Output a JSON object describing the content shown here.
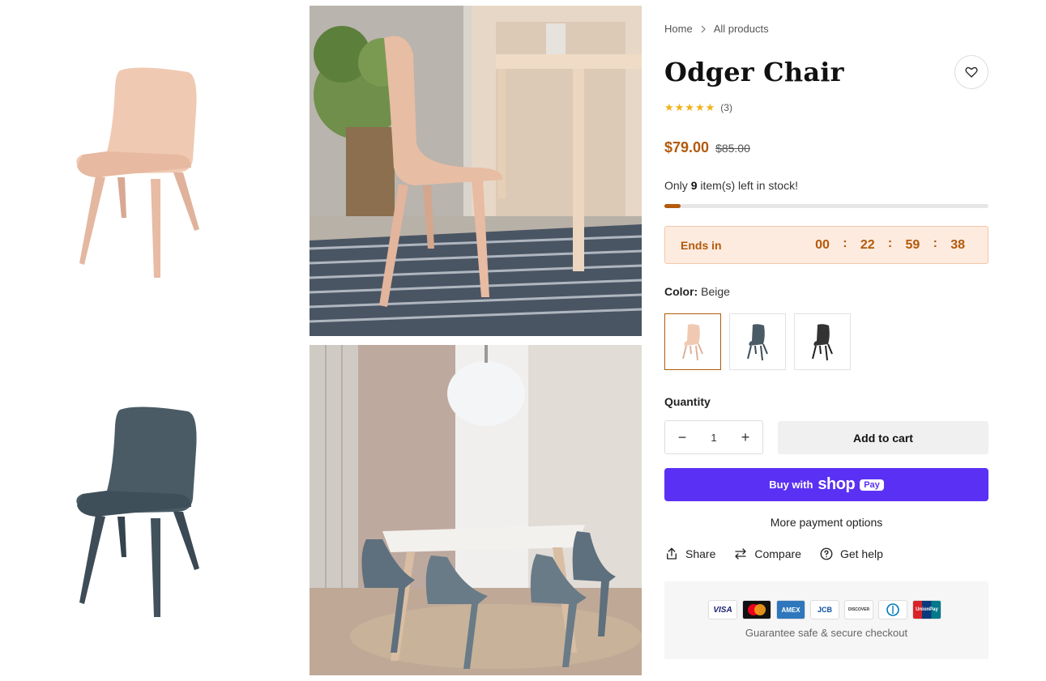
{
  "breadcrumb": {
    "home": "Home",
    "current": "All products"
  },
  "product": {
    "title": "Odger Chair",
    "rating_stars": "★★★★★",
    "review_count": "(3)",
    "price": "$79.00",
    "compare_price": "$85.00"
  },
  "stock": {
    "prefix": "Only",
    "count": "9",
    "suffix": "item(s) left in stock!",
    "progress_fraction": 0.05
  },
  "countdown": {
    "label": "Ends in",
    "days": "00",
    "hours": "22",
    "minutes": "59",
    "seconds": "38"
  },
  "color": {
    "label": "Color:",
    "selected": "Beige",
    "options": [
      "Beige",
      "Blue",
      "Black"
    ]
  },
  "quantity": {
    "label": "Quantity",
    "value": "1",
    "minus": "−",
    "plus": "+"
  },
  "buttons": {
    "add_to_cart": "Add to cart",
    "buy_with": "Buy with",
    "shop": "shop",
    "pay": "Pay",
    "more_payment": "More payment options"
  },
  "actions": {
    "share": "Share",
    "compare": "Compare",
    "help": "Get help"
  },
  "payment_cards": [
    "VISA",
    "MC",
    "AMEX",
    "JCB",
    "DISCOVER",
    "DINERS",
    "UnionPay"
  ],
  "secure_text": "Guarantee safe & secure checkout",
  "colors": {
    "accent": "#b35a0c",
    "shop_pay": "#5a31f4",
    "timer_bg": "#fdebdf"
  }
}
